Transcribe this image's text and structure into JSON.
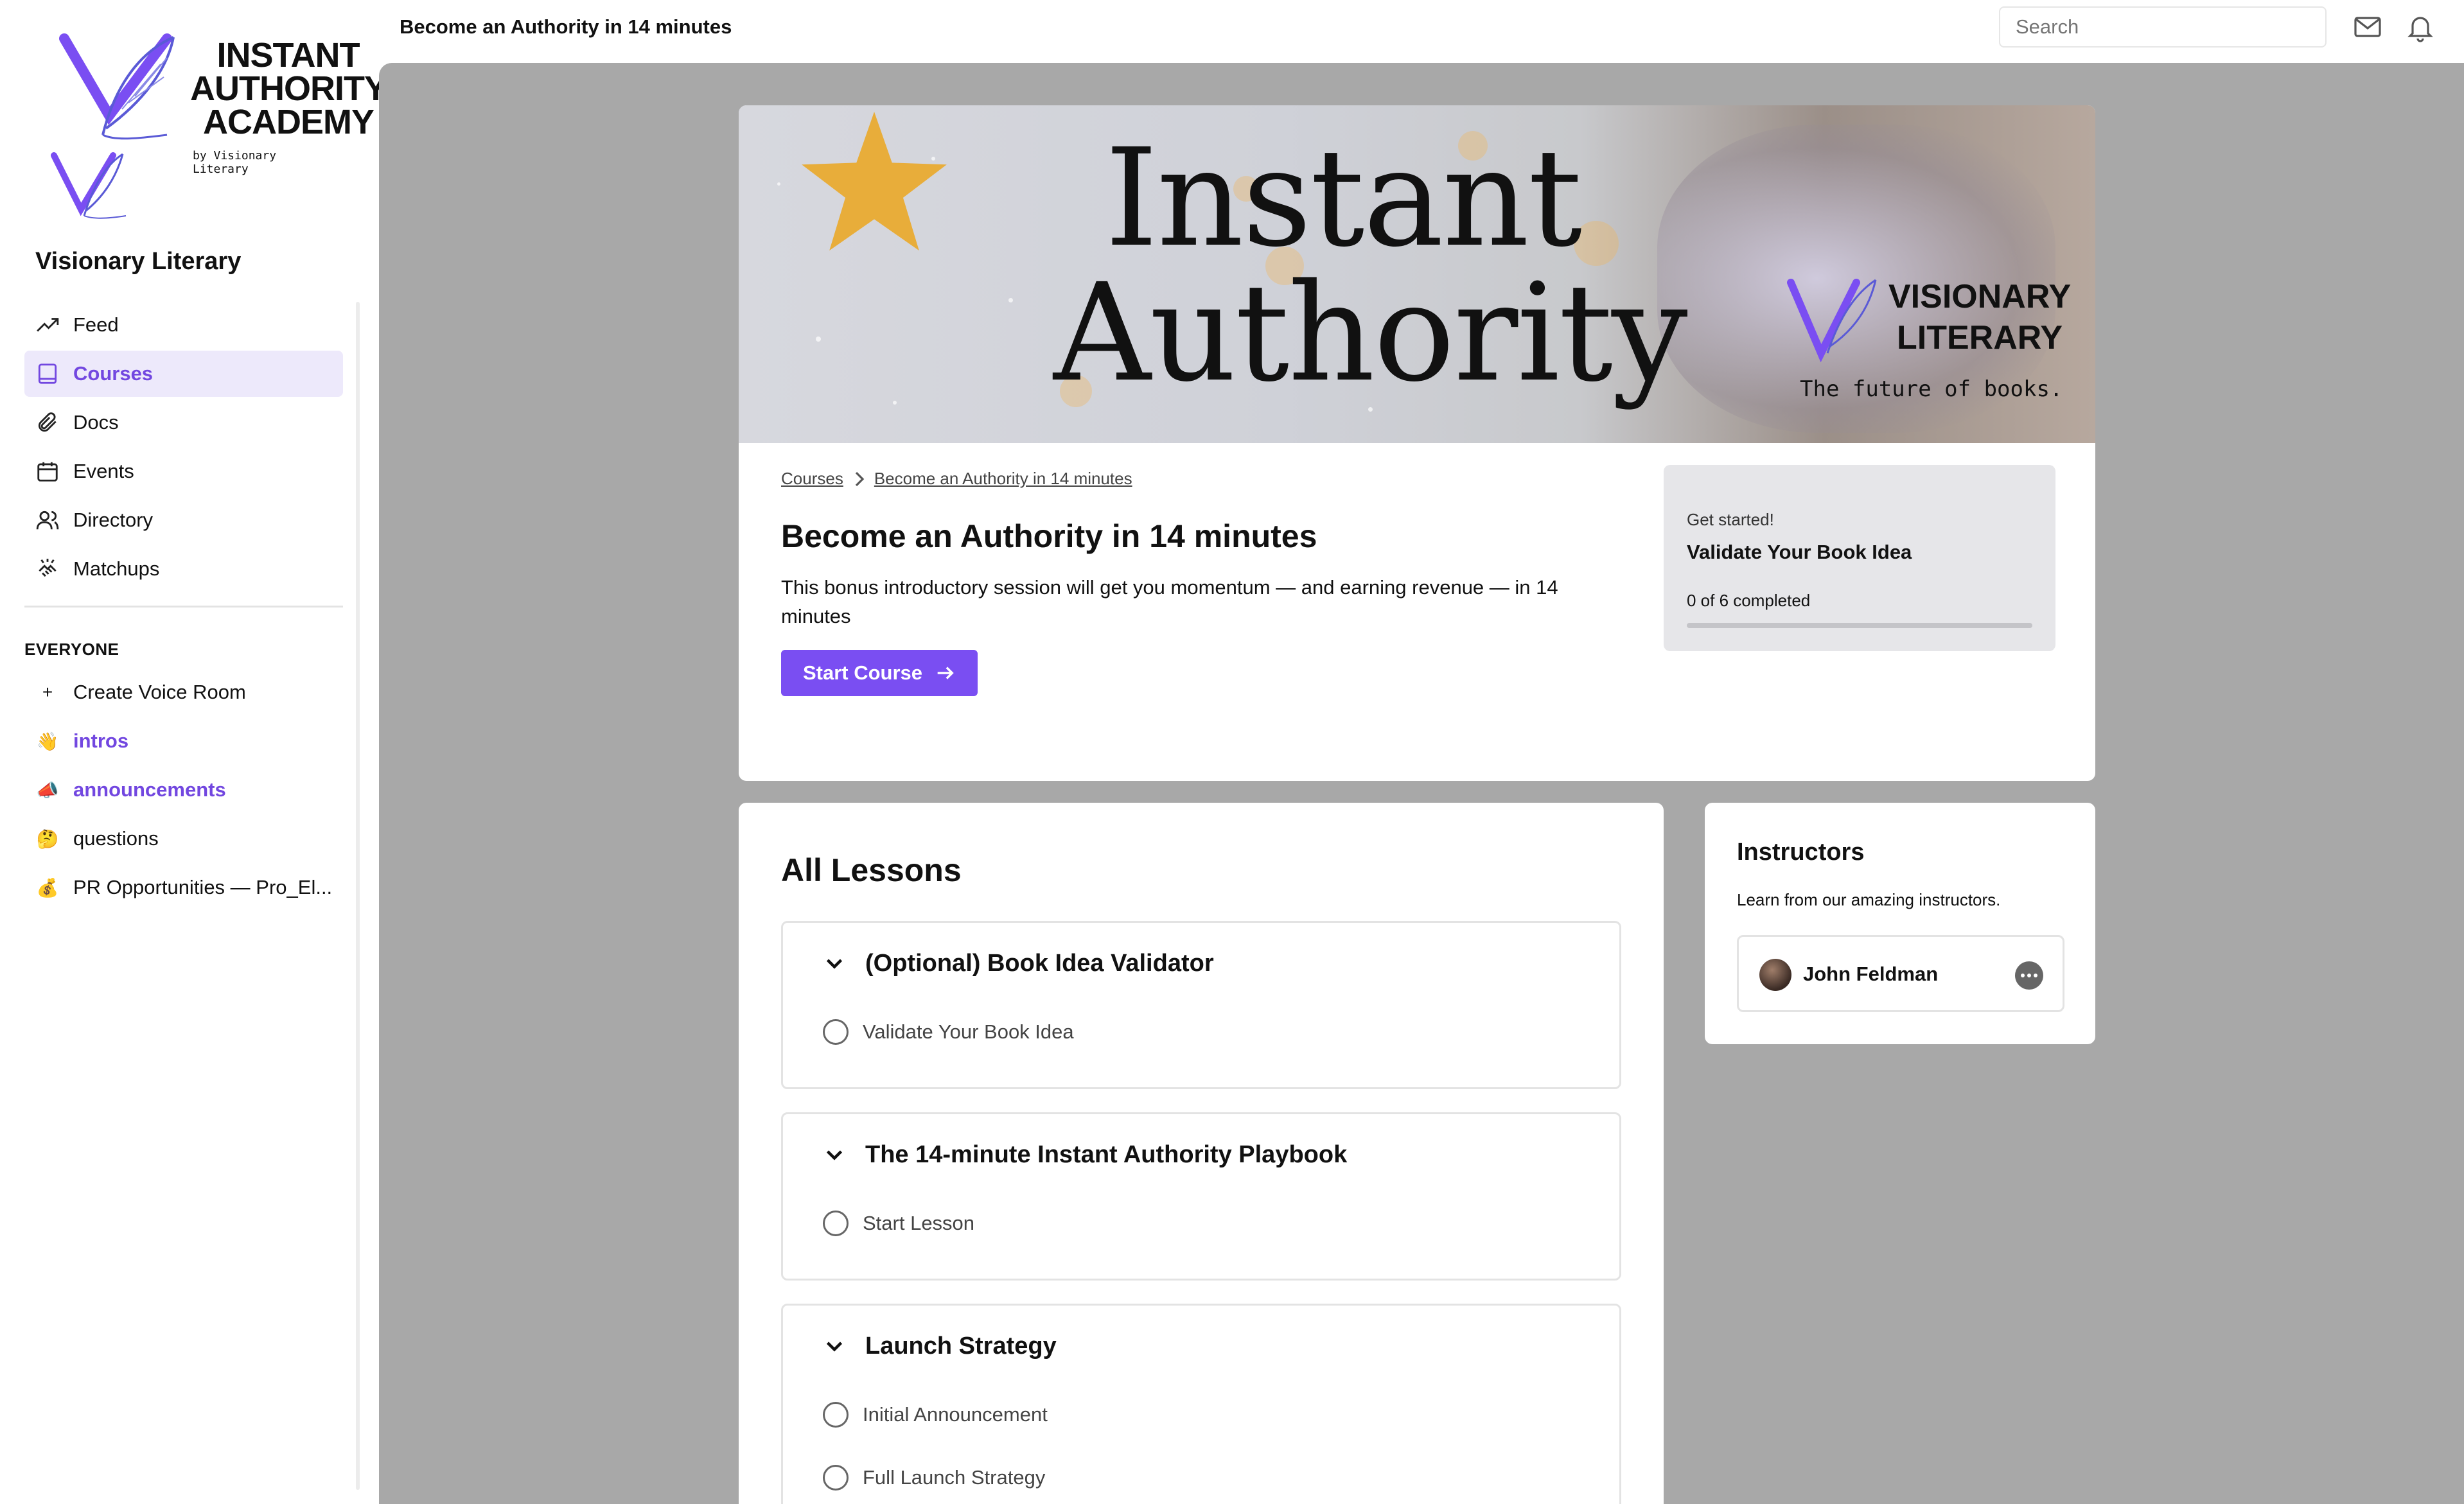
{
  "header": {
    "title": "Become an Authority in 14 minutes",
    "search_placeholder": "Search"
  },
  "sidebar": {
    "logo": {
      "line1": "INSTANT",
      "line2": "AUTHORITY",
      "line3": "ACADEMY",
      "sub": "by Visionary Literary"
    },
    "community_name": "Visionary Literary",
    "nav": [
      {
        "label": "Feed",
        "icon": "trending-icon"
      },
      {
        "label": "Courses",
        "icon": "book-icon",
        "active": true
      },
      {
        "label": "Docs",
        "icon": "paperclip-icon"
      },
      {
        "label": "Events",
        "icon": "calendar-icon"
      },
      {
        "label": "Directory",
        "icon": "users-icon"
      },
      {
        "label": "Matchups",
        "icon": "handshake-icon"
      }
    ],
    "section_label": "EVERYONE",
    "channels": [
      {
        "label": "Create Voice Room",
        "icon": "+"
      },
      {
        "label": "intros",
        "icon": "👋",
        "unread": true
      },
      {
        "label": "announcements",
        "icon": "📣",
        "unread": true
      },
      {
        "label": "questions",
        "icon": "🤔"
      },
      {
        "label": "PR Opportunities — Pro_El...",
        "icon": "💰"
      }
    ]
  },
  "course": {
    "banner": {
      "title_line1": "Instant",
      "title_line2": "Authority",
      "brand_line1": "VISIONARY",
      "brand_line2": "LITERARY",
      "tagline": "The future of books."
    },
    "breadcrumb": [
      "Courses",
      "Become an Authority in 14 minutes"
    ],
    "title": "Become an Authority in 14 minutes",
    "description": "This bonus introductory session will get you momentum — and earning revenue — in 14 minutes",
    "start_button": "Start Course",
    "progress": {
      "label": "Get started!",
      "title": "Validate Your Book Idea",
      "count_text": "0 of 6 completed",
      "fraction": 0
    }
  },
  "lessons": {
    "title": "All Lessons",
    "modules": [
      {
        "title": "(Optional) Book Idea Validator",
        "lessons": [
          "Validate Your Book Idea"
        ]
      },
      {
        "title": "The 14-minute Instant Authority Playbook",
        "lessons": [
          "Start Lesson"
        ]
      },
      {
        "title": "Launch Strategy",
        "lessons": [
          "Initial Announcement",
          "Full Launch Strategy"
        ]
      }
    ]
  },
  "instructors": {
    "title": "Instructors",
    "subtitle": "Learn from our amazing instructors.",
    "list": [
      {
        "name": "John Feldman"
      }
    ]
  },
  "colors": {
    "accent": "#7a4ef2",
    "active_bg": "#ede9fb",
    "canvas": "#a8a8a8",
    "star": "#e8ad3a"
  }
}
